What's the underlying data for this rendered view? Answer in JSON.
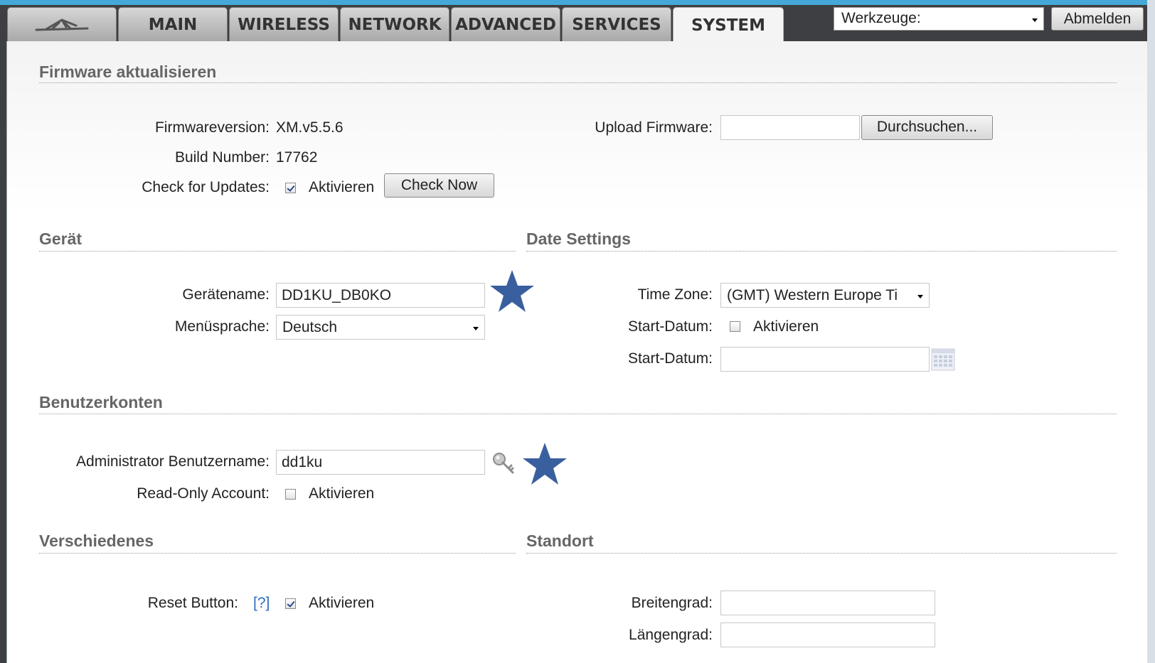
{
  "colors": {
    "accent_strip": "#45a8d8",
    "star": "#3a5f9e",
    "help_link": "#2a6fbf"
  },
  "nav": {
    "logo_icon": "ubiquiti-logo-icon",
    "tabs": [
      {
        "label": "MAIN"
      },
      {
        "label": "WIRELESS"
      },
      {
        "label": "NETWORK"
      },
      {
        "label": "ADVANCED"
      },
      {
        "label": "SERVICES"
      },
      {
        "label": "SYSTEM",
        "active": true
      }
    ],
    "tools_select": "Werkzeuge:",
    "logout_label": "Abmelden"
  },
  "firmware": {
    "title": "Firmware aktualisieren",
    "version_label": "Firmwareversion:",
    "version_value": "XM.v5.5.6",
    "build_label": "Build Number:",
    "build_value": "17762",
    "check_label": "Check for Updates:",
    "check_checked": true,
    "check_option": "Aktivieren",
    "check_now_label": "Check Now",
    "upload_label": "Upload Firmware:",
    "upload_value": "",
    "browse_label": "Durchsuchen..."
  },
  "device": {
    "title": "Gerät",
    "name_label": "Gerätename:",
    "name_value": "DD1KU_DB0KO",
    "lang_label": "Menüsprache:",
    "lang_value": "Deutsch"
  },
  "date_settings": {
    "title": "Date Settings",
    "tz_label": "Time Zone:",
    "tz_value": "(GMT) Western Europe Ti",
    "start_label": "Start-Datum:",
    "start_checked": false,
    "start_option": "Aktivieren",
    "start_date_label": "Start-Datum:",
    "start_date_value": ""
  },
  "accounts": {
    "title": "Benutzerkonten",
    "admin_label": "Administrator Benutzername:",
    "admin_value": "dd1ku",
    "readonly_label": "Read-Only Account:",
    "readonly_checked": false,
    "readonly_option": "Aktivieren"
  },
  "misc": {
    "title": "Verschiedenes",
    "reset_label": "Reset Button:",
    "reset_help": "[?]",
    "reset_checked": true,
    "reset_option": "Aktivieren"
  },
  "location": {
    "title": "Standort",
    "lat_label": "Breitengrad:",
    "lat_value": "",
    "lon_label": "Längengrad:",
    "lon_value": ""
  }
}
